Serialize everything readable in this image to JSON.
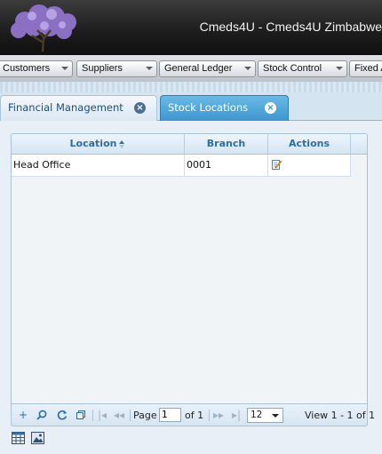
{
  "app": {
    "title": "Cmeds4U - Cmeds4U Zimbabwe"
  },
  "menu": {
    "items": [
      {
        "label": "Customers"
      },
      {
        "label": "Suppliers"
      },
      {
        "label": "General Ledger"
      },
      {
        "label": "Stock Control"
      },
      {
        "label": "Fixed Assets"
      }
    ]
  },
  "tabs": [
    {
      "label": "Financial Management",
      "active": false
    },
    {
      "label": "Stock Locations",
      "active": true
    }
  ],
  "grid": {
    "columns": [
      {
        "label": "Location",
        "sorted": "asc"
      },
      {
        "label": "Branch"
      },
      {
        "label": "Actions"
      }
    ],
    "rows": [
      {
        "location": "Head Office",
        "branch": "0001",
        "action_icon": "edit-icon"
      }
    ]
  },
  "pager": {
    "page_label": "Page",
    "page_value": "1",
    "of_label": "of 1",
    "rows_per_page": "12",
    "view_text": "View 1 - 1 of 1"
  },
  "colors": {
    "accent": "#2e6da4",
    "active_tab": "#3c97cf",
    "header_bg": "#1e1e1e"
  }
}
